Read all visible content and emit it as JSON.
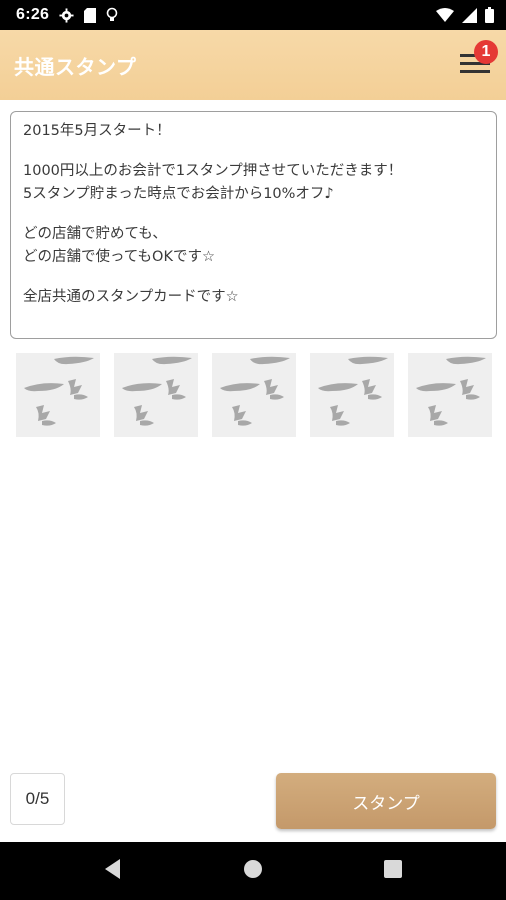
{
  "status_bar": {
    "time": "6:26",
    "icons": [
      "gear-icon",
      "sd-card-icon",
      "bulb-icon",
      "wifi-icon",
      "signal-icon",
      "battery-icon"
    ]
  },
  "app_bar": {
    "title": "共通スタンプ",
    "menu_icon": "hamburger-menu-icon",
    "badge_count": "1",
    "badge_color": "#e53935"
  },
  "description": {
    "lines": [
      "2015年5月スタート！",
      "",
      "1000円以上のお会計で1スタンプ押させていただきます！",
      "5スタンプ貯まった時点でお会計から10%オフ♪",
      "",
      "どの店舗で貯めても、",
      "どの店舗で使ってもOKです☆",
      "",
      "全店共通のスタンプカードです☆"
    ]
  },
  "stamps": {
    "total": 5,
    "collected": 0,
    "placeholder_icon": "brush-stamp-placeholder-icon"
  },
  "footer": {
    "counter": "0/5",
    "stamp_button_label": "スタンプ",
    "accent_color": "#c9a171"
  },
  "nav_bar": {
    "icons": [
      "back-icon",
      "home-icon",
      "recents-icon"
    ]
  }
}
